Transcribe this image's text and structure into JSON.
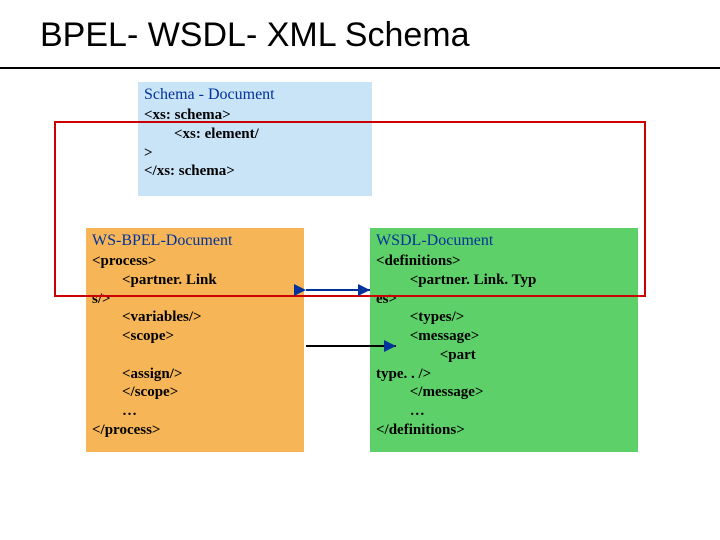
{
  "title": "BPEL- WSDL- XML Schema",
  "schema": {
    "title": "Schema - Document",
    "line1": "<xs: schema>",
    "line2": "        <xs: element/",
    "line3": ">",
    "line4": "</xs: schema>"
  },
  "bpel": {
    "title": "WS-BPEL-Document",
    "line1": "<process>",
    "line2": "        <partner. Link",
    "line3": "s/>",
    "line4": "        <variables/>",
    "line5": "        <scope>",
    "line6": "",
    "line7": "        <assign/>",
    "line8": "        </scope>",
    "line9": "        …",
    "line10": "</process>"
  },
  "wsdl": {
    "title": "WSDL-Document",
    "line1": "<definitions>",
    "line2": "         <partner. Link. Typ",
    "line3": "es>",
    "line4": "         <types/>",
    "line5": "         <message>",
    "line6": "                 <part",
    "line7": "type. . />",
    "line8": "         </message>",
    "line9": "         …",
    "line10": "</definitions>"
  }
}
